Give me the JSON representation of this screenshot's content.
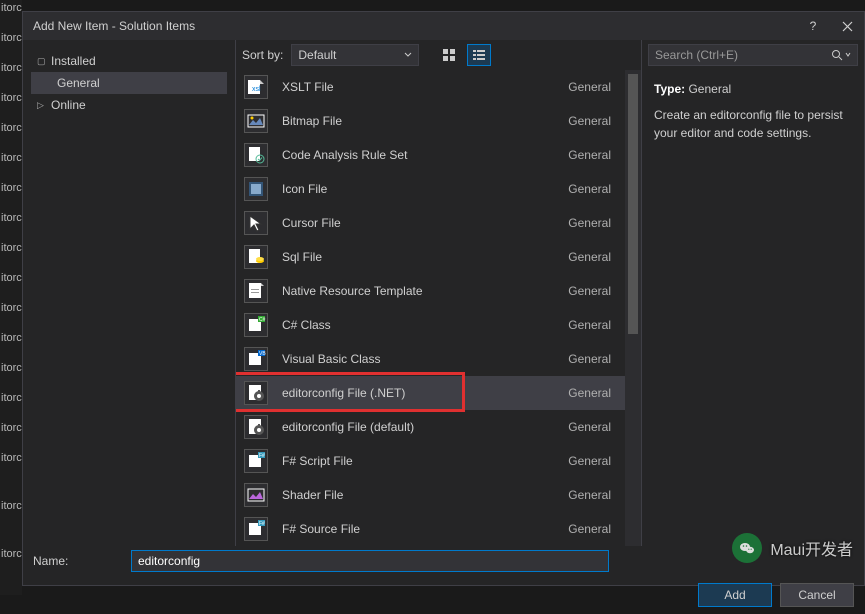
{
  "bg_labels": [
    "itorconfig",
    "itorc",
    "itorc",
    "itorc",
    "itorc",
    "itorc",
    "itorc",
    "itorc",
    "itorc",
    "itorc",
    "itorc",
    "itorc",
    "itorc",
    "itorc",
    "itorc",
    "itorc",
    "",
    "itorc",
    "",
    "itorconfig"
  ],
  "dialog": {
    "title": "Add New Item - Solution Items",
    "help_icon": "?",
    "close_icon": "✕"
  },
  "left": {
    "installed": "Installed",
    "general": "General",
    "online": "Online"
  },
  "toolbar": {
    "sort_label": "Sort by:",
    "sort_value": "Default"
  },
  "items": [
    {
      "label": "XSLT File",
      "cat": "General",
      "icon": "xslt"
    },
    {
      "label": "Bitmap File",
      "cat": "General",
      "icon": "bitmap"
    },
    {
      "label": "Code Analysis Rule Set",
      "cat": "General",
      "icon": "ruleset"
    },
    {
      "label": "Icon File",
      "cat": "General",
      "icon": "icon"
    },
    {
      "label": "Cursor File",
      "cat": "General",
      "icon": "cursor"
    },
    {
      "label": "Sql File",
      "cat": "General",
      "icon": "sql"
    },
    {
      "label": "Native Resource Template",
      "cat": "General",
      "icon": "resource"
    },
    {
      "label": "C# Class",
      "cat": "General",
      "icon": "csharp"
    },
    {
      "label": "Visual Basic Class",
      "cat": "General",
      "icon": "vb"
    },
    {
      "label": "editorconfig File (.NET)",
      "cat": "General",
      "icon": "editorconfig",
      "selected": true,
      "highlighted": true
    },
    {
      "label": "editorconfig File (default)",
      "cat": "General",
      "icon": "editorconfig"
    },
    {
      "label": "F# Script File",
      "cat": "General",
      "icon": "fsharp"
    },
    {
      "label": "Shader File",
      "cat": "General",
      "icon": "shader"
    },
    {
      "label": "F# Source File",
      "cat": "General",
      "icon": "fsharp"
    }
  ],
  "search": {
    "placeholder": "Search (Ctrl+E)"
  },
  "desc": {
    "type_label": "Type:",
    "type_value": "General",
    "text": "Create an editorconfig file to persist your editor and code settings."
  },
  "name_row": {
    "label": "Name:",
    "value": "editorconfig"
  },
  "buttons": {
    "add": "Add",
    "cancel": "Cancel"
  },
  "watermark": "Maui开发者"
}
